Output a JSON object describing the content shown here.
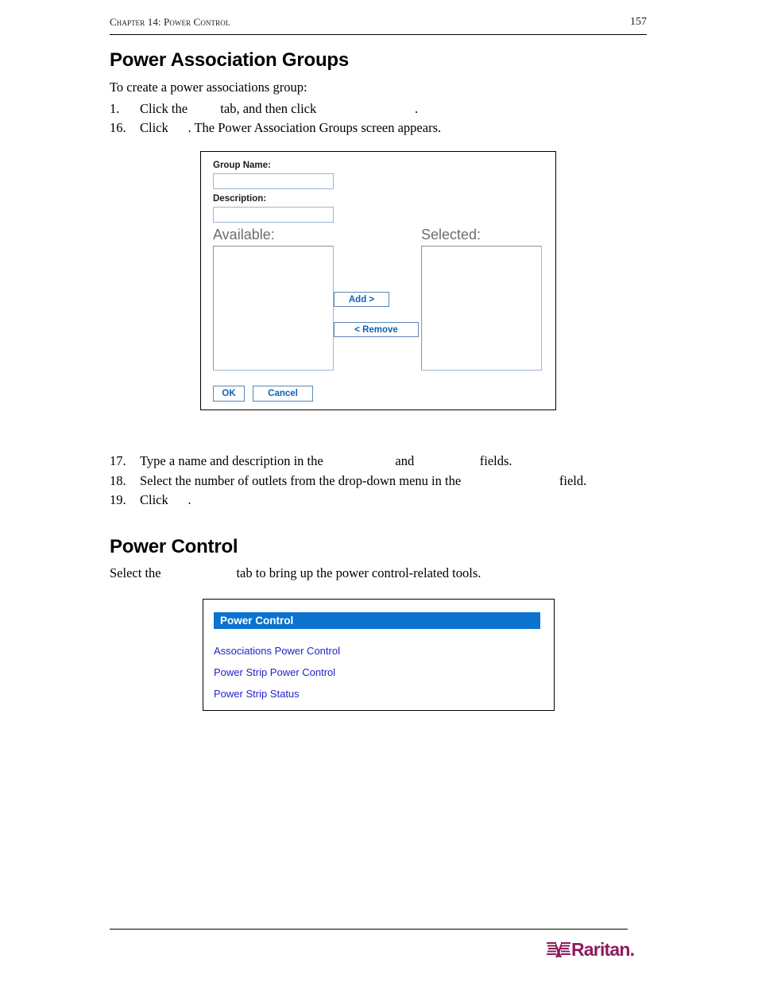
{
  "header": {
    "chapter_title": "Chapter 14: Power Control",
    "page_number": "157"
  },
  "sections": {
    "power_association_groups": {
      "heading": "Power Association Groups",
      "intro": "To create a power associations group:",
      "steps": [
        {
          "number": "1.",
          "text": "Click the          tab, and then click                              ."
        },
        {
          "number": "16.",
          "text": "Click      . The Power Association Groups screen appears."
        }
      ]
    },
    "after_dialog_steps": [
      {
        "number": "17.",
        "text": "Type a name and description in the                      and                    fields."
      },
      {
        "number": "18.",
        "text": "Select the number of outlets from the drop-down menu in the                              field."
      },
      {
        "number": "19.",
        "text": "Click      ."
      }
    ],
    "power_control": {
      "heading": "Power Control",
      "intro": "Select the                       tab to bring up the power control-related tools."
    }
  },
  "dialog": {
    "group_name_label": "Group Name:",
    "group_name_value": "",
    "group_name_placeholder": "",
    "description_label": "Description:",
    "description_value": "",
    "description_placeholder": "",
    "available_label": "Available:",
    "selected_label": "Selected:",
    "available_items": [],
    "selected_items": [],
    "add_button": "Add >",
    "remove_button": "< Remove",
    "ok_button": "OK",
    "cancel_button": "Cancel"
  },
  "power_control_panel": {
    "title": "Power Control",
    "links": [
      "Associations Power Control",
      "Power Strip Power Control",
      "Power Strip Status"
    ]
  },
  "footer": {
    "logo_text": "Raritan",
    "logo_dot": ".",
    "logo_mark_name": "raritan-logo-mark"
  },
  "colors": {
    "panel_header_blue": "#0b72cf",
    "link_blue": "#2222cc",
    "button_blue": "#0b63b8",
    "field_border": "#9fb6cd",
    "brand_magenta": "#8e1b5d"
  }
}
